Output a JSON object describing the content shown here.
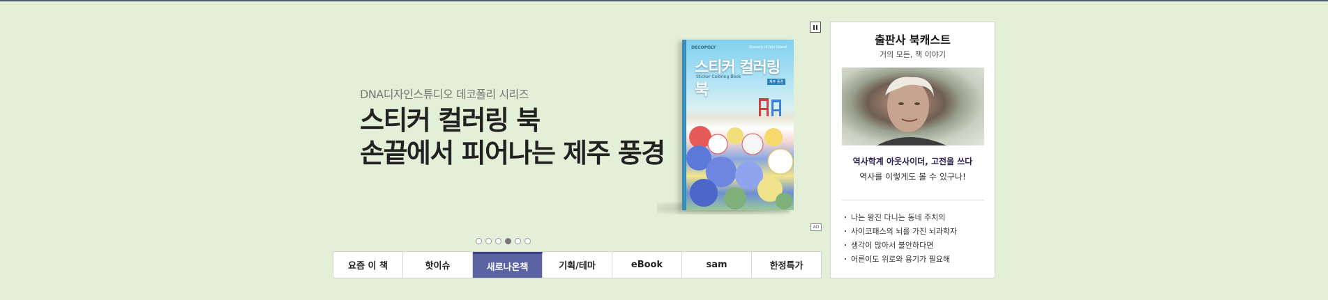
{
  "banner": {
    "series": "DNA디자인스튜디오 데코폴리 시리즈",
    "headline_line1": "스티커 컬러링 북",
    "headline_line2": "손끝에서 피어나는 제주 풍경",
    "book": {
      "brand": "DECOPOLY",
      "title": "스티커 컬러링 북",
      "en_title": "Scenery of Jeju Island",
      "subtitle": "Sticker Coloring Book",
      "tag": "제주 풍경"
    },
    "ad_label": "AD",
    "pause_icon": "pause-icon",
    "dots": {
      "count": 6,
      "active_index": 3
    }
  },
  "tabs": [
    {
      "label": "요즘 이 책",
      "active": false
    },
    {
      "label": "핫이슈",
      "active": false
    },
    {
      "label": "새로나온책",
      "active": true
    },
    {
      "label": "기획/테마",
      "active": false
    },
    {
      "label": "eBook",
      "active": false
    },
    {
      "label": "sam",
      "active": false
    },
    {
      "label": "한정특가",
      "active": false
    }
  ],
  "side_card": {
    "title": "출판사 북캐스트",
    "subtitle": "거의 모든, 책 이야기",
    "feature_title": "역사학계 아웃사이더, 고전을 쓰다",
    "feature_sub": "역사를 이렇게도 볼 수 있구나!",
    "list": [
      "나는 왕진 다니는 동네 주치의",
      "사이코패스의 뇌를 가진 뇌과학자",
      "생각이 많아서 불안하다면",
      "어른이도 위로와 용기가 필요해"
    ]
  },
  "colors": {
    "background": "#e3efd6",
    "active_tab": "#5b63a2"
  }
}
